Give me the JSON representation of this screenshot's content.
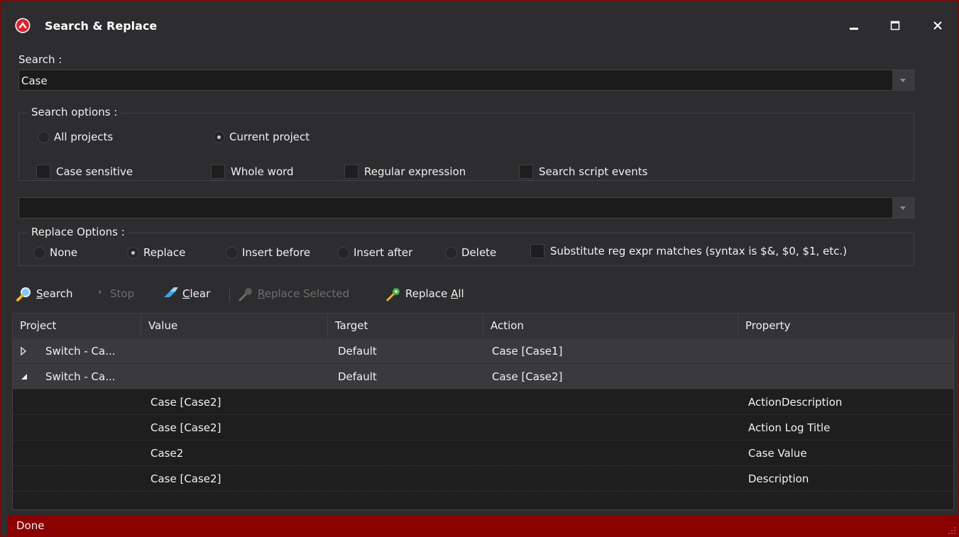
{
  "window": {
    "title": "Search & Replace",
    "accent_color": "#8b0000",
    "background_color": "#2d2d30"
  },
  "search": {
    "label": "Search :",
    "value": "Case"
  },
  "search_options": {
    "title": "Search options :",
    "radios": [
      {
        "label": "All projects",
        "checked": false
      },
      {
        "label": "Current project",
        "checked": true
      }
    ],
    "checkboxes": [
      {
        "label": "Case sensitive",
        "checked": false
      },
      {
        "label": "Whole word",
        "checked": false
      },
      {
        "label": "Regular expression",
        "checked": false
      },
      {
        "label": "Search script events",
        "checked": false
      }
    ]
  },
  "replace": {
    "value": ""
  },
  "replace_options": {
    "title": "Replace Options :",
    "radios": [
      {
        "label": "None",
        "checked": false
      },
      {
        "label": "Replace",
        "checked": true
      },
      {
        "label": "Insert before",
        "checked": false
      },
      {
        "label": "Insert after",
        "checked": false
      },
      {
        "label": "Delete",
        "checked": false
      }
    ],
    "substitute_checkbox": {
      "label": "Substitute reg expr matches (syntax is $&, $0, $1, etc.)",
      "checked": false
    }
  },
  "toolbar": {
    "search": {
      "pre": "",
      "mnemonic": "S",
      "post": "earch",
      "enabled": true,
      "icon": "magnifier-icon"
    },
    "stop": {
      "label": "Stop",
      "enabled": false,
      "icon": "stop-icon"
    },
    "clear": {
      "pre": "",
      "mnemonic": "C",
      "post": "lear",
      "enabled": true,
      "icon": "eraser-icon"
    },
    "replace_selected": {
      "pre": "",
      "mnemonic": "R",
      "post": "eplace Selected",
      "enabled": false,
      "icon": "wand-icon"
    },
    "replace_all": {
      "pre": "Replace ",
      "mnemonic": "A",
      "post": "ll",
      "enabled": true,
      "icon": "wand-icon"
    }
  },
  "grid": {
    "columns": [
      "Project",
      "Value",
      "Target",
      "Action",
      "Property"
    ],
    "rows": [
      {
        "type": "group",
        "expanded": false,
        "project": "Switch - Ca...",
        "value": "",
        "target": "Default",
        "action": "Case [Case1]",
        "property": ""
      },
      {
        "type": "group",
        "expanded": true,
        "project": "Switch - Ca...",
        "value": "",
        "target": "Default",
        "action": "Case [Case2]",
        "property": ""
      },
      {
        "type": "item",
        "project": "",
        "value": "Case [Case2]",
        "target": "",
        "action": "",
        "property": "ActionDescription"
      },
      {
        "type": "item",
        "project": "",
        "value": "Case [Case2]",
        "target": "",
        "action": "",
        "property": "Action Log Title"
      },
      {
        "type": "item",
        "project": "",
        "value": "Case2",
        "target": "",
        "action": "",
        "property": "Case Value"
      },
      {
        "type": "item",
        "project": "",
        "value": "Case [Case2]",
        "target": "",
        "action": "",
        "property": "Description"
      }
    ]
  },
  "status": {
    "text": "Done"
  }
}
